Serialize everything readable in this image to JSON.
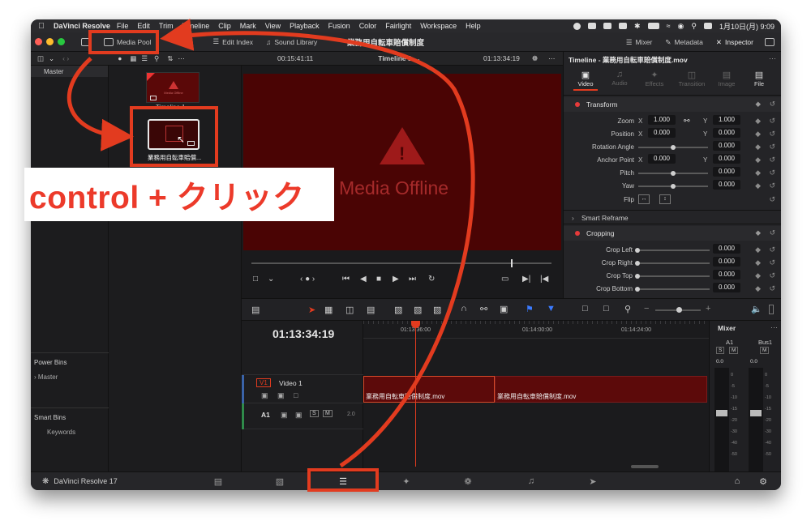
{
  "menubar": {
    "app": "DaVinci Resolve",
    "items": [
      "File",
      "Edit",
      "Trim",
      "Timeline",
      "Clip",
      "Mark",
      "View",
      "Playback",
      "Fusion",
      "Color",
      "Fairlight",
      "Workspace",
      "Help"
    ],
    "datetime": "1月10日(月)  9:09"
  },
  "toolbar": {
    "media_pool": "Media Pool",
    "edit_index": "Edit Index",
    "sound_library": "Sound Library",
    "project_title": "業務用自転車賠償制度",
    "mixer": "Mixer",
    "metadata": "Metadata",
    "inspector": "Inspector"
  },
  "subbar": {
    "timecode_left": "00:15:41:11",
    "timeline_name": "Timeline 1",
    "timecode_right": "01:13:34:19",
    "inspector_target": "Timeline - 業務用自転車賠償制度.mov"
  },
  "bins": {
    "master": "Master",
    "power_bins": "Power Bins",
    "power_master": "Master",
    "smart_bins": "Smart Bins",
    "keywords": "Keywords"
  },
  "pool": {
    "timeline_thumb_label": "Timeline 1",
    "clip_label": "業務用自転車賠償...",
    "offline_small": "Media Offline"
  },
  "viewer": {
    "offline_text": "Media Offline"
  },
  "inspector": {
    "tabs": [
      "Video",
      "Audio",
      "Effects",
      "Transition",
      "Image",
      "File"
    ],
    "transform": "Transform",
    "zoom_label": "Zoom",
    "zoom_x": "1.000",
    "zoom_y": "1.000",
    "position_label": "Position",
    "position_x": "0.000",
    "position_y": "0.000",
    "rotation_label": "Rotation Angle",
    "rotation": "0.000",
    "anchor_label": "Anchor Point",
    "anchor_x": "0.000",
    "anchor_y": "0.000",
    "pitch_label": "Pitch",
    "pitch": "0.000",
    "yaw_label": "Yaw",
    "yaw": "0.000",
    "flip_label": "Flip",
    "smart_reframe": "Smart Reframe",
    "cropping": "Cropping",
    "crop_left_label": "Crop Left",
    "crop_left": "0.000",
    "crop_right_label": "Crop Right",
    "crop_right": "0.000",
    "crop_top_label": "Crop Top",
    "crop_top": "0.000",
    "crop_bottom_label": "Crop Bottom",
    "crop_bottom": "0.000",
    "axis_x": "X",
    "axis_y": "Y"
  },
  "timeline": {
    "timecode": "01:13:34:19",
    "ruler": [
      "01:13:36:00",
      "01:14:00:00",
      "01:14:24:00"
    ],
    "v1_tag": "V1",
    "v1_name": "Video 1",
    "a1_tag": "A1",
    "a1_level": "2.0",
    "clip1": "業務用自転車賠償制度.mov",
    "clip2": "業務用自転車賠償制度.mov",
    "solo": "S",
    "mute": "M"
  },
  "mixer": {
    "title": "Mixer",
    "ch1": "A1",
    "ch2": "Bus1",
    "level1": "0.0",
    "level2": "0.0",
    "scale": [
      "0",
      "-5",
      "-10",
      "-15",
      "-20",
      "-30",
      "-40",
      "-50"
    ]
  },
  "bottom": {
    "version": "DaVinci Resolve 17"
  },
  "annotation": {
    "callout": "control + クリック"
  },
  "colors": {
    "accent_red": "#e23b1f",
    "offline_red": "#4a0404"
  }
}
